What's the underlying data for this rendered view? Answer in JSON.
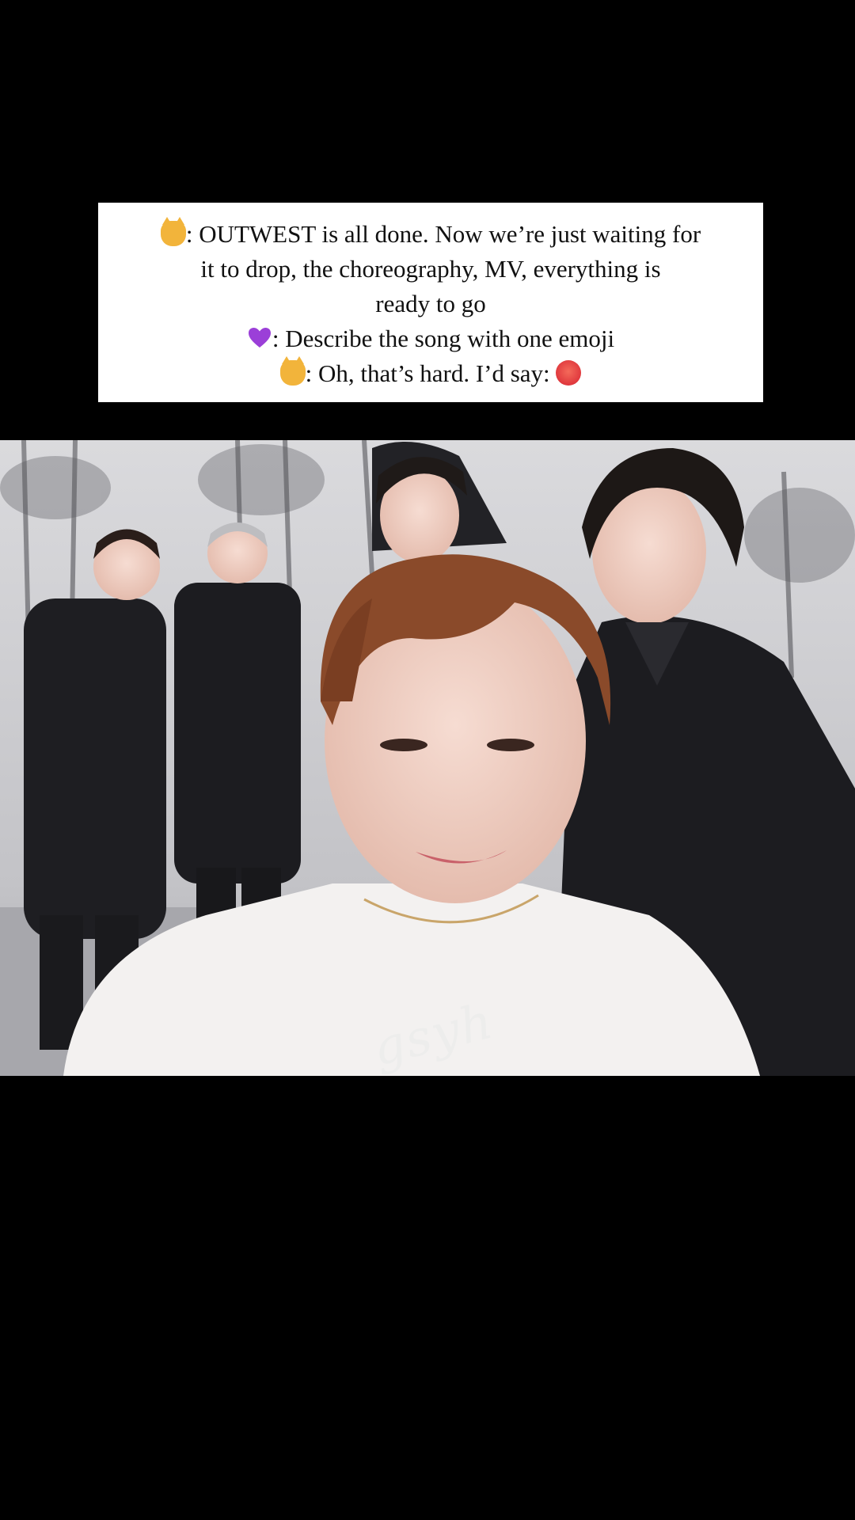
{
  "caption": {
    "lines": [
      {
        "emoji": "cat-face",
        "text": ": OUTWEST is all done. Now we’re just waiting for"
      },
      {
        "emoji": null,
        "text": "it to drop, the choreography, MV, everything is"
      },
      {
        "emoji": null,
        "text": "ready to go"
      },
      {
        "emoji": "purple-heart",
        "text": ": Describe the song with one emoji"
      },
      {
        "emoji": "cat-face",
        "text": ": Oh, that’s hard. I’d say: ",
        "trailing_emoji": "hot-face"
      }
    ]
  },
  "photo": {
    "description_icon": "group-photo",
    "colors": {
      "background": "#c8c8cc",
      "bamboo": "#3a3a3e",
      "clothes_dark": "#1b1b1f",
      "shirt": "#f3f1f0",
      "hair_front": "#8a4a2a"
    }
  },
  "watermark": {
    "text": "gsyh"
  }
}
